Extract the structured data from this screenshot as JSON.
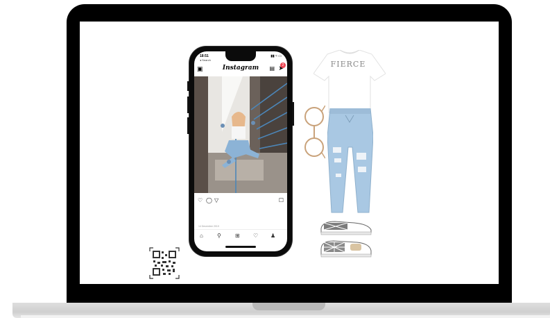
{
  "phone": {
    "status_time": "18:51",
    "status_back": "◂ Search",
    "status_signal": "▮▮ ≈ ▭",
    "app_logo": "Instagram",
    "dm_badge": "2",
    "post_date": "14 December 2019",
    "icons": {
      "header": [
        "camera-icon",
        "igtv-icon",
        "direct-message-icon"
      ],
      "actions": [
        "heart-icon",
        "comment-icon",
        "share-icon",
        "bookmark-icon"
      ],
      "tabs": [
        "home-icon",
        "search-icon",
        "add-post-icon",
        "activity-icon",
        "profile-icon"
      ]
    }
  },
  "products": {
    "tshirt_print": "FIERCE",
    "items": [
      "tshirt",
      "glasses",
      "ripped-jeans",
      "checkered-slip-on-shoes"
    ]
  },
  "colors": {
    "laptop_frame": "#000000",
    "laptop_base": "#d4d4d4",
    "denim": "#a9c8e3",
    "ig_badge": "#ed4956"
  }
}
